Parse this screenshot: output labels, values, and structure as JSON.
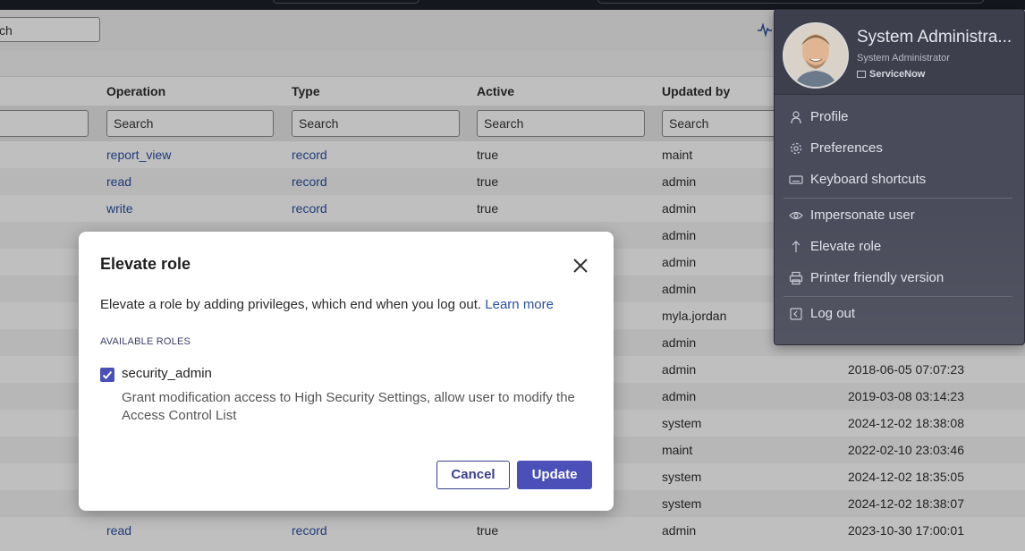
{
  "toolbar": {
    "search_text": "ch"
  },
  "table": {
    "columns": [
      "Operation",
      "Type",
      "Active",
      "Updated by"
    ],
    "search_placeholder": "Search",
    "rows": [
      {
        "operation": "report_view",
        "type": "record",
        "active": "true",
        "updated_by": "maint",
        "updated": ""
      },
      {
        "operation": "read",
        "type": "record",
        "active": "true",
        "updated_by": "admin",
        "updated": ""
      },
      {
        "operation": "write",
        "type": "record",
        "active": "true",
        "updated_by": "admin",
        "updated": ""
      },
      {
        "operation": "",
        "type": "",
        "active": "",
        "updated_by": "admin",
        "updated": ""
      },
      {
        "operation": "",
        "type": "",
        "active": "",
        "updated_by": "admin",
        "updated": ""
      },
      {
        "operation": "",
        "type": "",
        "active": "",
        "updated_by": "admin",
        "updated": ""
      },
      {
        "operation": "",
        "type": "",
        "active": "",
        "updated_by": "myla.jordan",
        "updated": ""
      },
      {
        "operation": "",
        "type": "",
        "active": "",
        "updated_by": "admin",
        "updated": ""
      },
      {
        "operation": "",
        "type": "",
        "active": "",
        "updated_by": "admin",
        "updated": "2018-06-05 07:07:23"
      },
      {
        "operation": "",
        "type": "",
        "active": "",
        "updated_by": "admin",
        "updated": "2019-03-08 03:14:23"
      },
      {
        "operation": "",
        "type": "",
        "active": "",
        "updated_by": "system",
        "updated": "2024-12-02 18:38:08"
      },
      {
        "operation": "",
        "type": "",
        "active": "",
        "updated_by": "maint",
        "updated": "2022-02-10 23:03:46"
      },
      {
        "operation": "",
        "type": "",
        "active": "",
        "updated_by": "system",
        "updated": "2024-12-02 18:35:05"
      },
      {
        "operation": "",
        "type": "",
        "active": "",
        "updated_by": "system",
        "updated": "2024-12-02 18:38:07"
      },
      {
        "operation": "read",
        "type": "record",
        "active": "true",
        "updated_by": "admin",
        "updated": "2023-10-30 17:00:01"
      }
    ]
  },
  "modal": {
    "title": "Elevate role",
    "description": "Elevate a role by adding privileges, which end when you log out.",
    "learn_more": "Learn more",
    "roles_heading": "AVAILABLE ROLES",
    "role": {
      "name": "security_admin",
      "checked": true,
      "description": "Grant modification access to High Security Settings, allow user to modify the Access Control List"
    },
    "cancel_label": "Cancel",
    "update_label": "Update"
  },
  "user_menu": {
    "name": "System Administra...",
    "role": "System Administrator",
    "company": "ServiceNow",
    "items": [
      {
        "label": "Profile",
        "icon": "user-icon"
      },
      {
        "label": "Preferences",
        "icon": "gear-icon"
      },
      {
        "label": "Keyboard shortcuts",
        "icon": "keyboard-icon"
      },
      {
        "label": "Impersonate user",
        "icon": "eye-icon"
      },
      {
        "label": "Elevate role",
        "icon": "arrow-up-icon"
      },
      {
        "label": "Printer friendly version",
        "icon": "printer-icon"
      },
      {
        "label": "Log out",
        "icon": "logout-icon"
      }
    ]
  },
  "colors": {
    "accent": "#4b4fb8",
    "link": "#2b4f9f",
    "menu_bg": "#4a4b5a"
  }
}
